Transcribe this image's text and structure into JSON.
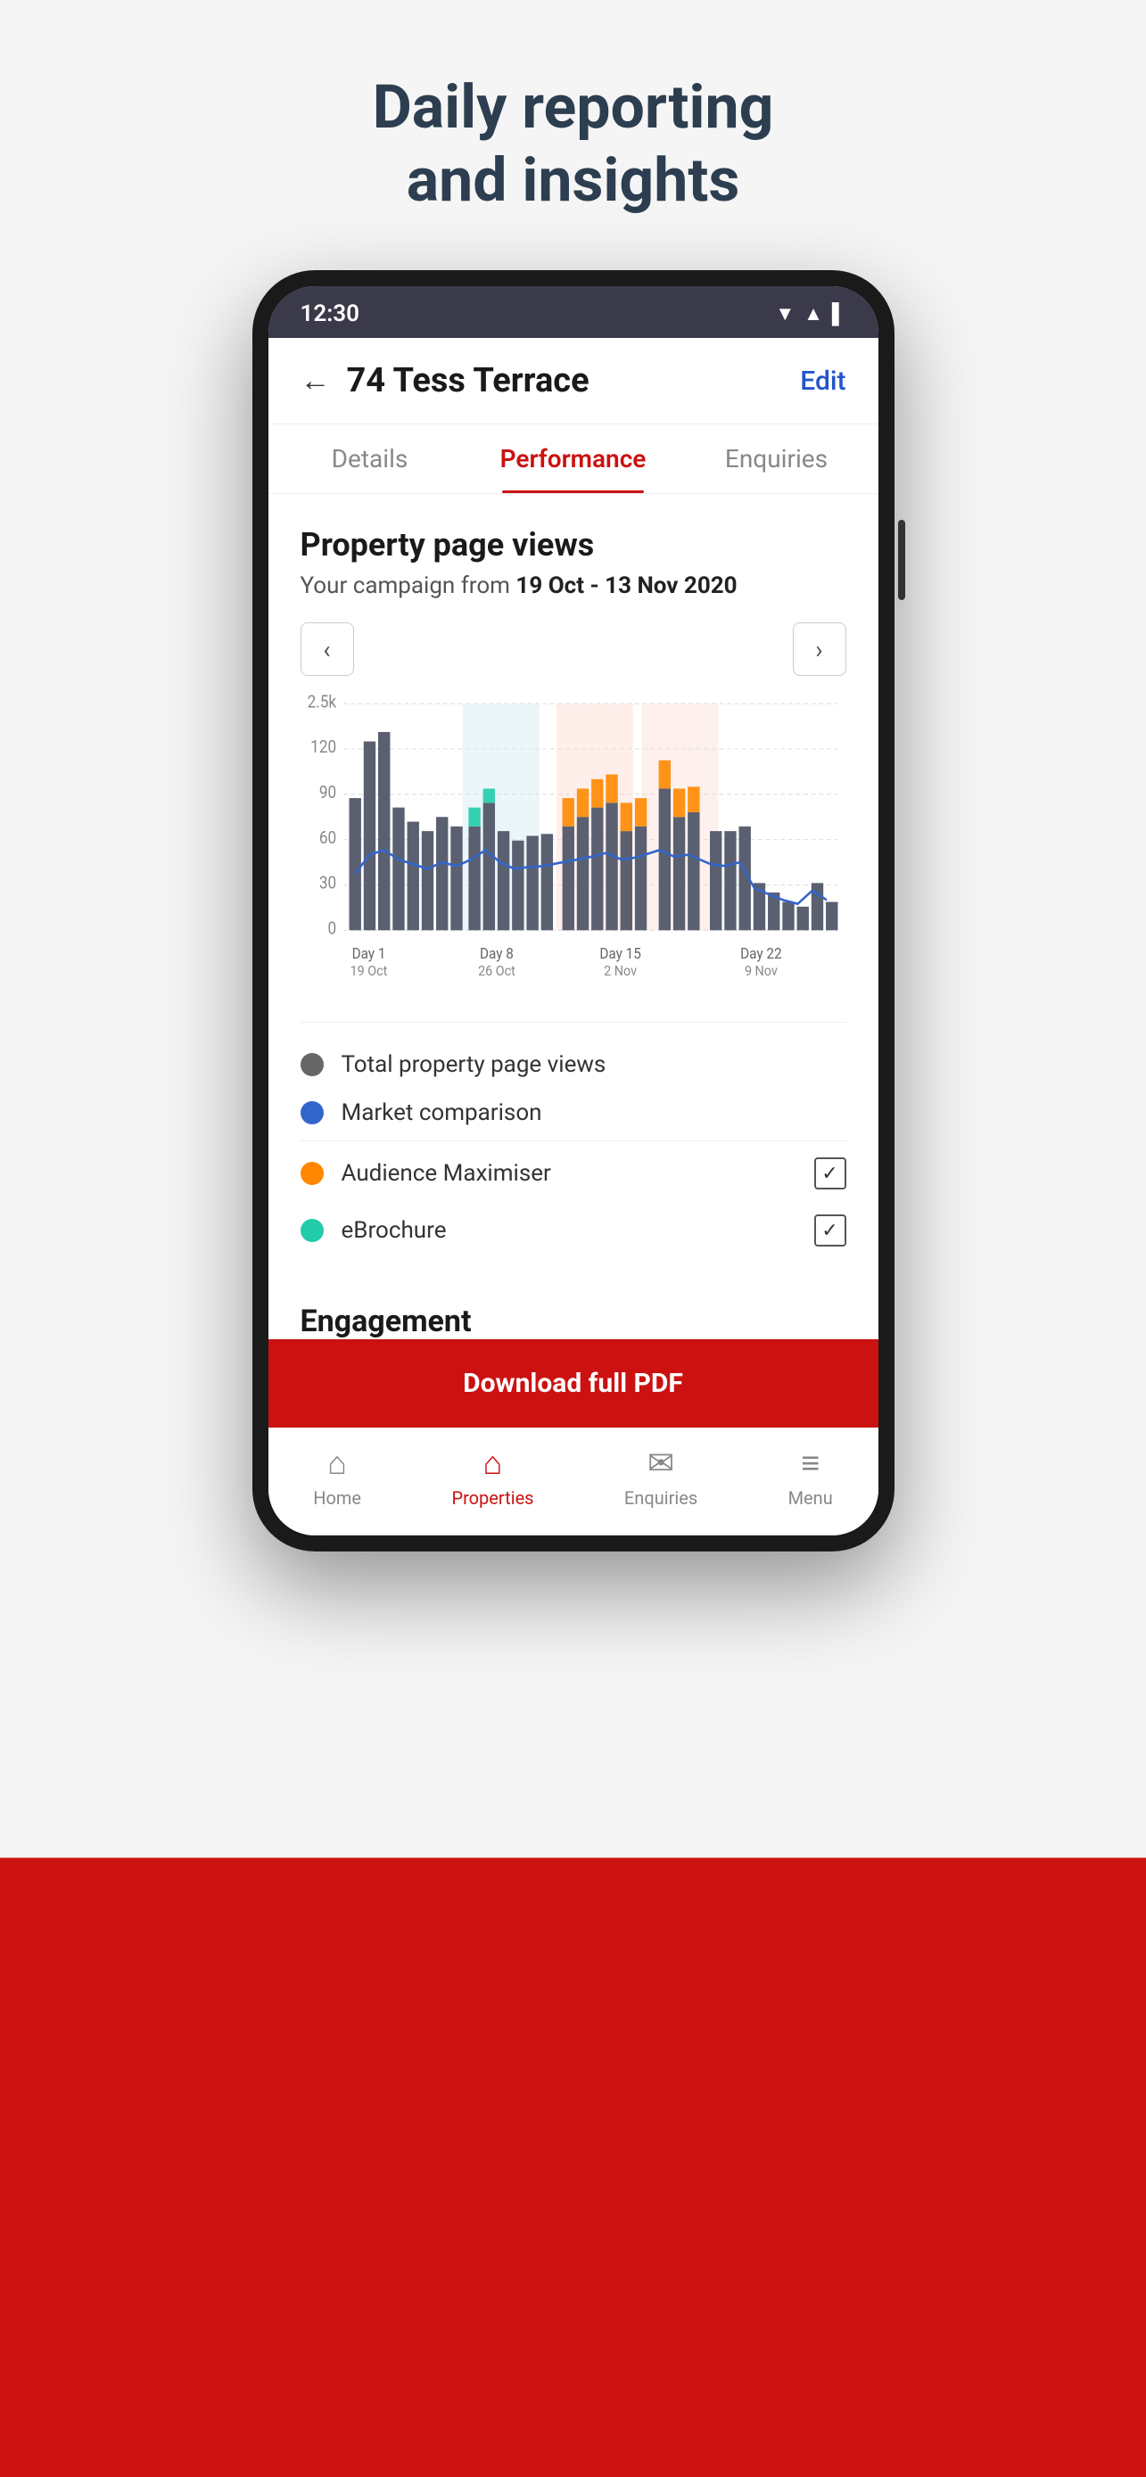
{
  "headline": {
    "line1": "Daily reporting",
    "line2": "and insights"
  },
  "statusBar": {
    "time": "12:30",
    "icons": [
      "▼",
      "▲",
      "▌"
    ]
  },
  "header": {
    "title": "74 Tess Terrace",
    "editLabel": "Edit"
  },
  "tabs": [
    {
      "id": "details",
      "label": "Details",
      "active": false
    },
    {
      "id": "performance",
      "label": "Performance",
      "active": true
    },
    {
      "id": "enquiries",
      "label": "Enquiries",
      "active": false
    }
  ],
  "chart": {
    "sectionTitle": "Property page views",
    "campaignText": "Your campaign from ",
    "campaignDates": "19 Oct - 13 Nov 2020",
    "yLabels": [
      "2.5k",
      "120",
      "90",
      "60",
      "30",
      "0"
    ],
    "xLabels": [
      {
        "day": "Day 1",
        "date": "19 Oct"
      },
      {
        "day": "Day 8",
        "date": "26 Oct"
      },
      {
        "day": "Day 15",
        "date": "2 Nov"
      },
      {
        "day": "Day 22",
        "date": "9 Nov"
      }
    ],
    "prevBtn": "‹",
    "nextBtn": "›"
  },
  "legend": [
    {
      "id": "total-views",
      "color": "#666",
      "label": "Total property page views",
      "hasCheckbox": false
    },
    {
      "id": "market-comparison",
      "color": "#3366cc",
      "label": "Market comparison",
      "hasCheckbox": false
    },
    {
      "id": "audience-maximiser",
      "color": "#ff8800",
      "label": "Audience Maximiser",
      "hasCheckbox": true,
      "checked": true
    },
    {
      "id": "ebrochure",
      "color": "#22ccaa",
      "label": "eBrochure",
      "hasCheckbox": true,
      "checked": true
    }
  ],
  "engagement": {
    "title": "Engagement"
  },
  "downloadBar": {
    "label": "Download full PDF"
  },
  "bottomNav": [
    {
      "id": "home",
      "label": "Home",
      "icon": "⌂",
      "active": false
    },
    {
      "id": "properties",
      "label": "Properties",
      "icon": "⌂",
      "active": true
    },
    {
      "id": "enquiries",
      "label": "Enquiries",
      "icon": "✉",
      "active": false
    },
    {
      "id": "menu",
      "label": "Menu",
      "icon": "≡",
      "active": false
    }
  ]
}
